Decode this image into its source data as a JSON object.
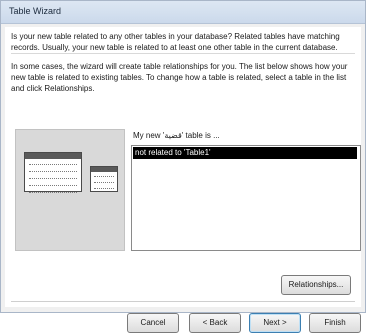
{
  "window": {
    "title": "Table Wizard"
  },
  "intro": {
    "question": "Is your new table related to any other tables in your database? Related tables have matching records. Usually, your new table is related to at least one other table in the current database.",
    "instructions": "In some cases, the wizard will create table relationships for you. The list below shows how your new table is related to existing tables. To change how a table is related, select a table in the list and click Relationships."
  },
  "list": {
    "caption": "My new 'قضية' table is ...",
    "items": [
      "not related to 'Table1'"
    ],
    "selected_index": 0
  },
  "buttons": {
    "relationships": "Relationships...",
    "cancel": "Cancel",
    "back": "< Back",
    "next": "Next >",
    "finish": "Finish"
  }
}
